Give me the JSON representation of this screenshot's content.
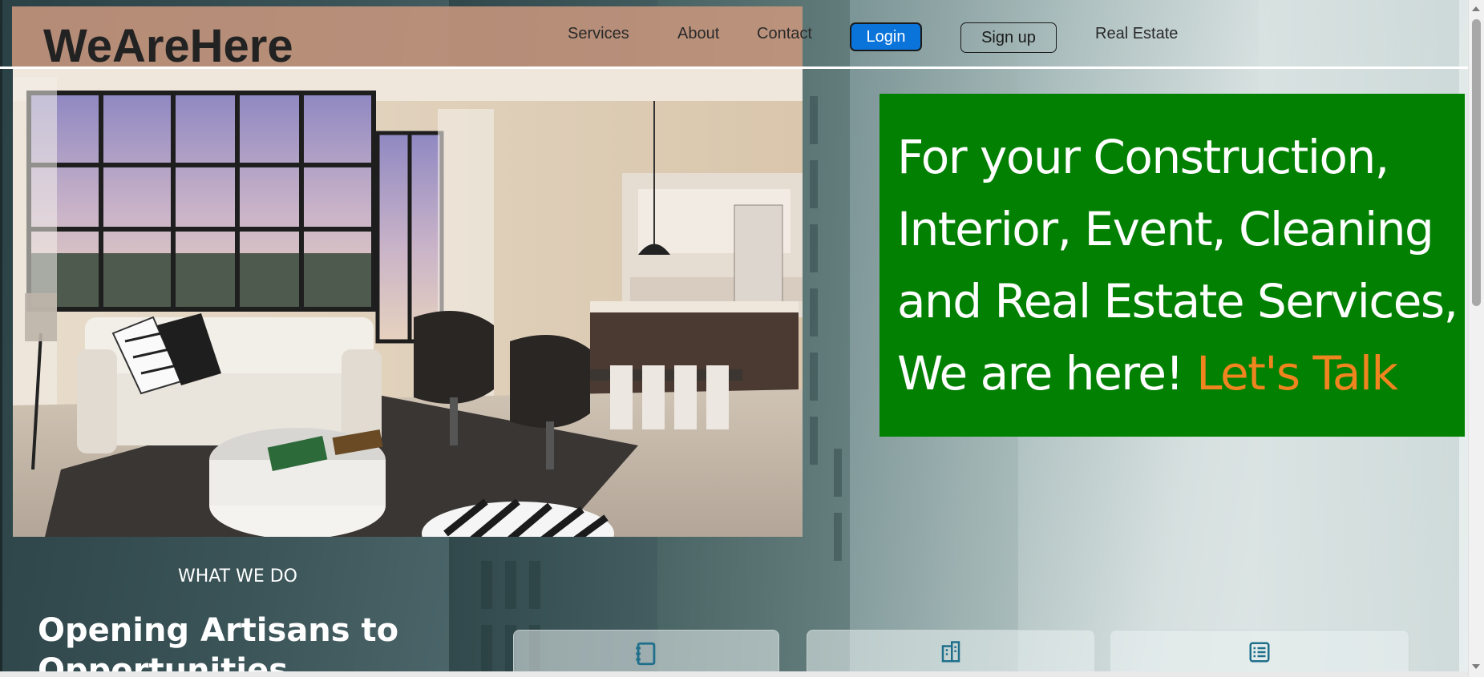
{
  "brand": {
    "logo_text": "WeAreHere"
  },
  "nav": {
    "items": [
      {
        "label": "Services"
      },
      {
        "label": "About"
      },
      {
        "label": "Contact"
      }
    ],
    "login_label": "Login",
    "signup_label": "Sign up",
    "real_estate_label": "Real Estate"
  },
  "hero": {
    "headline_lines": [
      "For your Construction,",
      "Interior, Event, Cleaning",
      "and Real Estate Services,",
      "We are here! "
    ],
    "cta_text": "Let's Talk",
    "card_color": "#028002",
    "accent_color": "#f0841e"
  },
  "section": {
    "eyebrow": "WHAT WE DO",
    "title": "Opening Artisans to Opportunities"
  },
  "service_cards": [
    {
      "icon": "notebook-icon"
    },
    {
      "icon": "building-icon"
    },
    {
      "icon": "list-icon"
    }
  ],
  "colors": {
    "login_button": "#0a74da",
    "topbar": "#c8967d"
  }
}
